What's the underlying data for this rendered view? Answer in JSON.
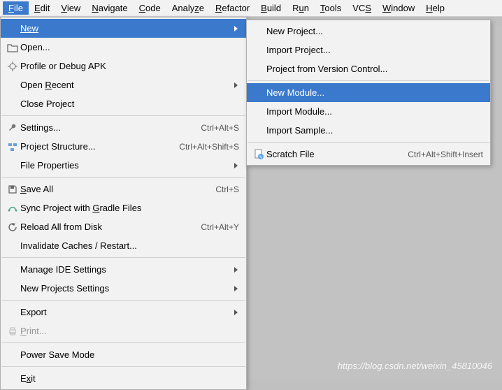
{
  "menubar": {
    "items": [
      {
        "label": "File",
        "u": 0
      },
      {
        "label": "Edit",
        "u": 0
      },
      {
        "label": "View",
        "u": 0
      },
      {
        "label": "Navigate",
        "u": 0
      },
      {
        "label": "Code",
        "u": 0
      },
      {
        "label": "Analyze",
        "u": 5
      },
      {
        "label": "Refactor",
        "u": 0
      },
      {
        "label": "Build",
        "u": 0
      },
      {
        "label": "Run",
        "u": 1
      },
      {
        "label": "Tools",
        "u": 0
      },
      {
        "label": "VCS",
        "u": 2
      },
      {
        "label": "Window",
        "u": 0
      },
      {
        "label": "Help",
        "u": 0
      }
    ]
  },
  "file_menu": {
    "new": {
      "label": "New",
      "u": 0,
      "arrow": true
    },
    "open": {
      "label": "Open..."
    },
    "profile": {
      "label": "Profile or Debug APK"
    },
    "open_recent": {
      "label": "Open Recent",
      "u": 5,
      "arrow": true
    },
    "close_project": {
      "label": "Close Project"
    },
    "settings": {
      "label": "Settings...",
      "shortcut": "Ctrl+Alt+S"
    },
    "proj_structure": {
      "label": "Project Structure...",
      "shortcut": "Ctrl+Alt+Shift+S"
    },
    "file_properties": {
      "label": "File Properties",
      "arrow": true
    },
    "save_all": {
      "label": "Save All",
      "u": 0,
      "shortcut": "Ctrl+S"
    },
    "sync_gradle": {
      "label": "Sync Project with Gradle Files",
      "u": 18
    },
    "reload_disk": {
      "label": "Reload All from Disk",
      "shortcut": "Ctrl+Alt+Y"
    },
    "invalidate": {
      "label": "Invalidate Caches / Restart..."
    },
    "manage_ide": {
      "label": "Manage IDE Settings",
      "arrow": true
    },
    "new_projects": {
      "label": "New Projects Settings",
      "arrow": true
    },
    "export": {
      "label": "Export",
      "arrow": true
    },
    "print": {
      "label": "Print...",
      "u": 0
    },
    "power_save": {
      "label": "Power Save Mode"
    },
    "exit": {
      "label": "Exit",
      "u": 1
    }
  },
  "new_submenu": {
    "new_project": {
      "label": "New Project..."
    },
    "import_project": {
      "label": "Import Project..."
    },
    "from_vcs": {
      "label": "Project from Version Control..."
    },
    "new_module": {
      "label": "New Module..."
    },
    "import_module": {
      "label": "Import Module..."
    },
    "import_sample": {
      "label": "Import Sample..."
    },
    "scratch": {
      "label": "Scratch File",
      "shortcut": "Ctrl+Alt+Shift+Insert"
    }
  },
  "watermark": "https://blog.csdn.net/weixin_45810046"
}
